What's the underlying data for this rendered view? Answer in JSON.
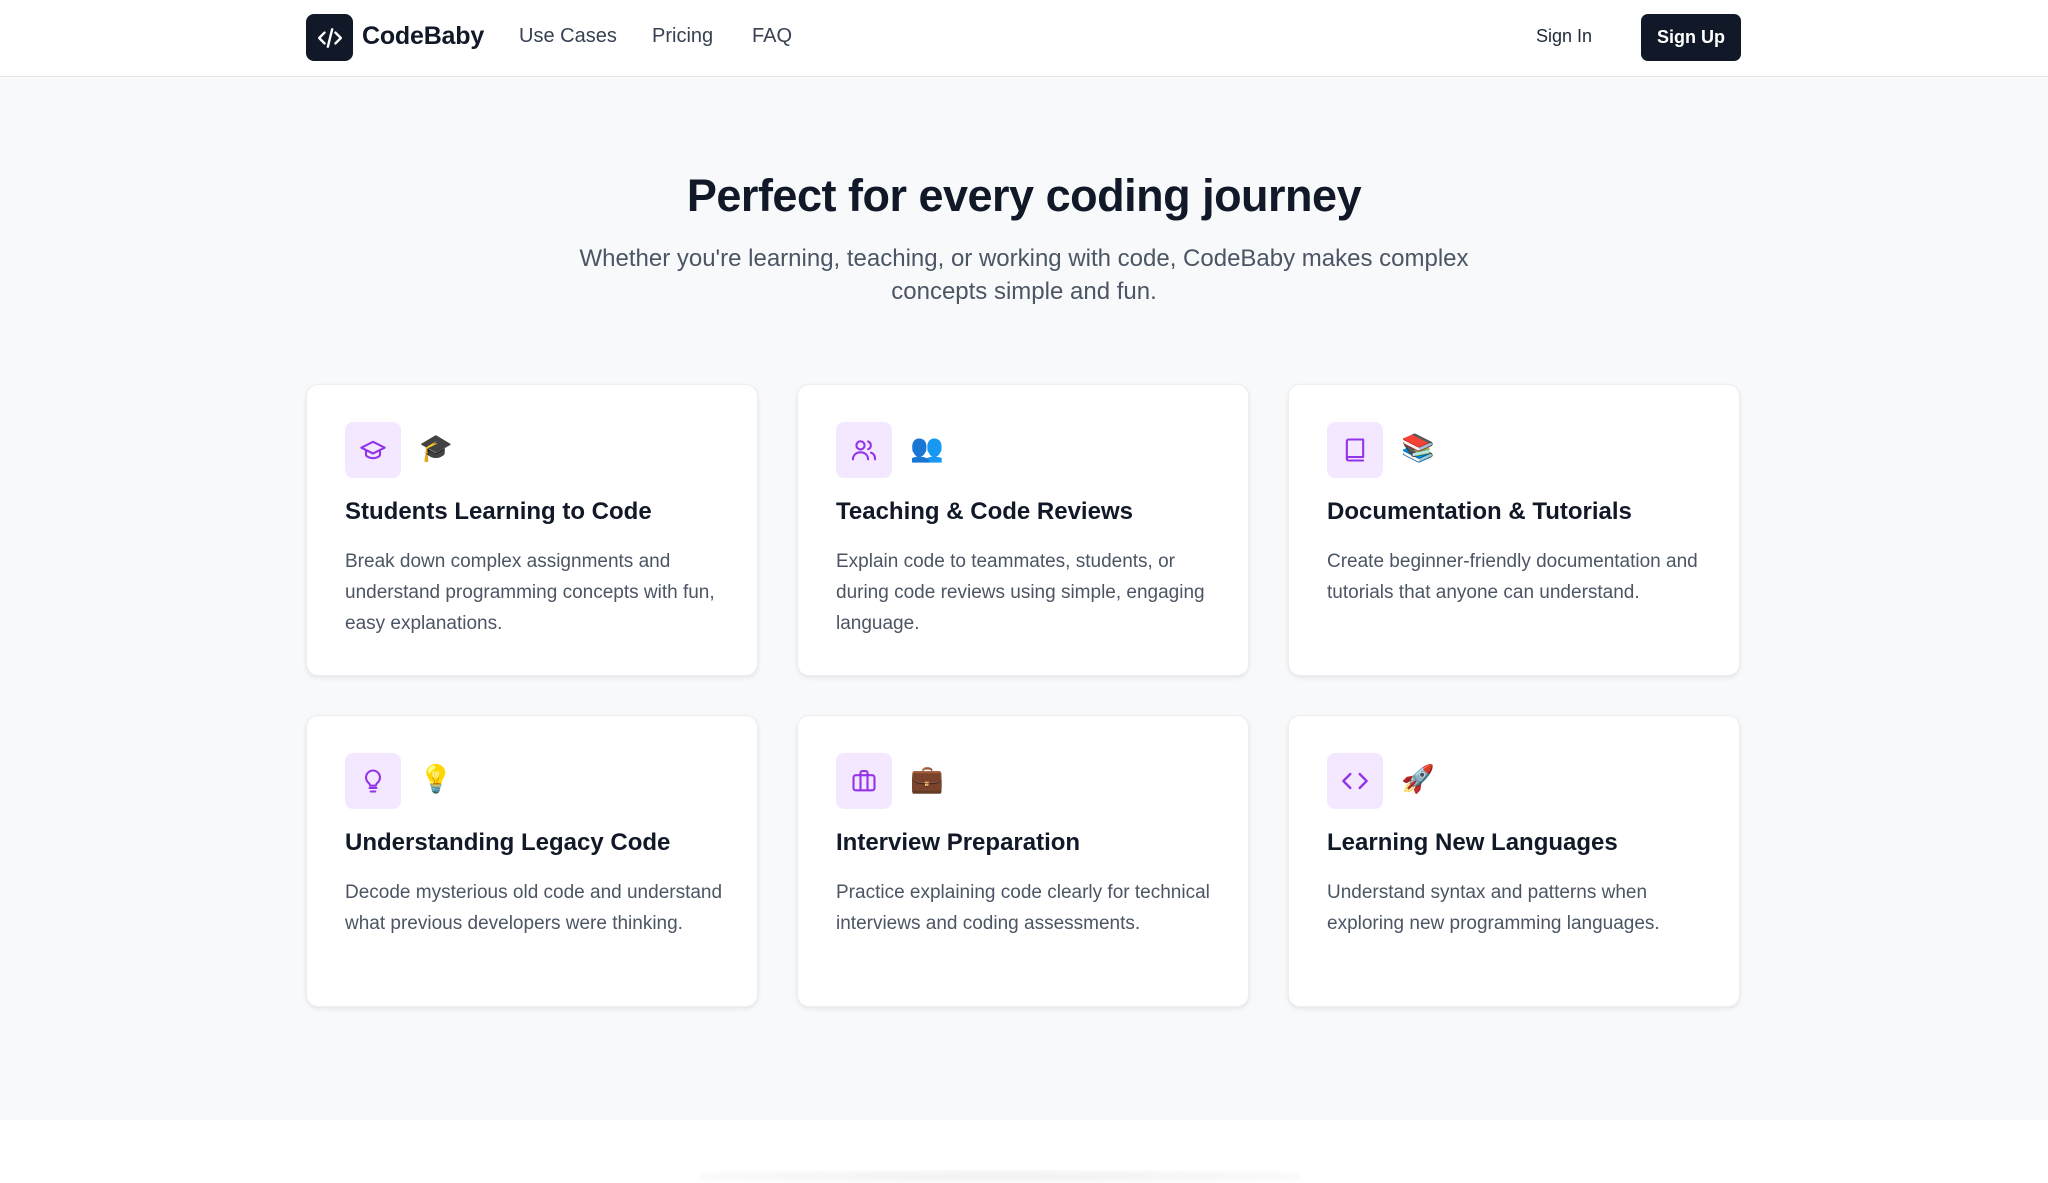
{
  "header": {
    "brand": "CodeBaby",
    "logo_icon": "code-brackets-icon",
    "nav": [
      "Use Cases",
      "Pricing",
      "FAQ"
    ],
    "sign_in": "Sign In",
    "sign_up": "Sign Up"
  },
  "hero": {
    "title": "Perfect for every coding journey",
    "subtitle": "Whether you're learning, teaching, or working with code, CodeBaby makes complex concepts simple and fun."
  },
  "colors": {
    "accent": "#9333ea",
    "accent_bg": "#f3e8ff",
    "dark": "#111827"
  },
  "cards": [
    {
      "icon": "graduation-cap-icon",
      "emoji": "🎓",
      "title": "Students Learning to Code",
      "description": "Break down complex assignments and understand programming concepts with fun, easy explanations."
    },
    {
      "icon": "users-icon",
      "emoji": "👥",
      "title": "Teaching & Code Reviews",
      "description": "Explain code to teammates, students, or during code reviews using simple, engaging language."
    },
    {
      "icon": "book-icon",
      "emoji": "📚",
      "title": "Documentation & Tutorials",
      "description": "Create beginner-friendly documentation and tutorials that anyone can understand."
    },
    {
      "icon": "lightbulb-icon",
      "emoji": "💡",
      "title": "Understanding Legacy Code",
      "description": "Decode mysterious old code and understand what previous developers were thinking."
    },
    {
      "icon": "briefcase-icon",
      "emoji": "💼",
      "title": "Interview Preparation",
      "description": "Practice explaining code clearly for technical interviews and coding assessments."
    },
    {
      "icon": "code-icon",
      "emoji": "🚀",
      "title": "Learning New Languages",
      "description": "Understand syntax and patterns when exploring new programming languages."
    }
  ]
}
